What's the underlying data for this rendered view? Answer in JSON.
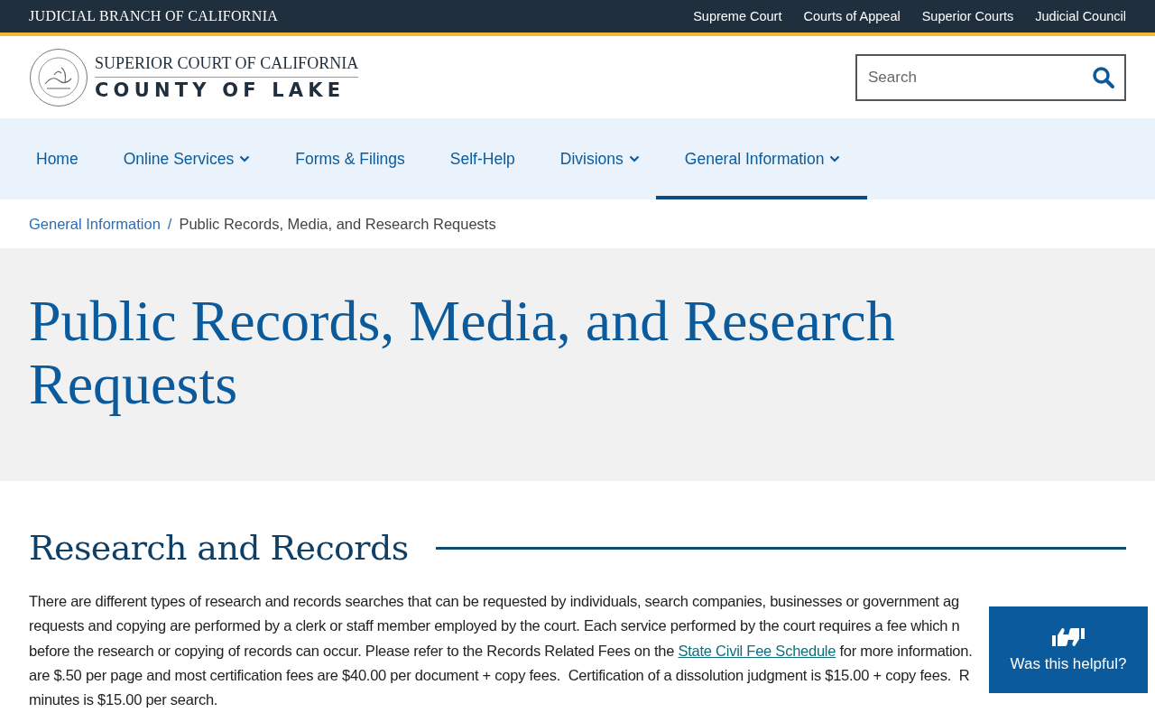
{
  "top_bar": {
    "title": "JUDICIAL BRANCH OF CALIFORNIA",
    "links": [
      "Supreme Court",
      "Courts of Appeal",
      "Superior Courts",
      "Judicial Council"
    ]
  },
  "header": {
    "logo_line_1": "SUPERIOR COURT OF CALIFORNIA",
    "logo_line_2": "COUNTY OF LAKE",
    "search": {
      "placeholder": "Search"
    }
  },
  "nav": [
    {
      "label": "Home",
      "dropdown": false,
      "selected": false
    },
    {
      "label": "Online Services",
      "dropdown": true,
      "selected": false
    },
    {
      "label": "Forms & Filings",
      "dropdown": false,
      "selected": false
    },
    {
      "label": "Self-Help",
      "dropdown": false,
      "selected": false
    },
    {
      "label": "Divisions",
      "dropdown": true,
      "selected": false
    },
    {
      "label": "General Information",
      "dropdown": true,
      "selected": true
    }
  ],
  "breadcrumb": {
    "link": "General Information",
    "separator": "/",
    "current": "Public Records, Media, and Research Requests"
  },
  "page_title": "Public Records, Media, and Research Requests",
  "section": {
    "heading": "Research and Records",
    "lines": [
      {
        "before": "There are different types of research and records searches that can be requested by individuals, search companies, businesses or government ag"
      },
      {
        "before": "requests and copying are performed by a clerk or staff member employed by the court. Each service performed by the court requires a fee which n"
      },
      {
        "before": "before the research or copying of records can occur. Please refer to the Records Related Fees on the ",
        "link": "State Civil Fee Schedule",
        "after": " for more information."
      },
      {
        "before": "are $.50 per page and most certification fees are $40.00 per document + copy fees.  Certification of a dissolution judgment is $15.00 + copy fees.  R"
      },
      {
        "before": "minutes is $15.00 per search."
      }
    ]
  },
  "feedback": {
    "label": "Was this helpful?"
  }
}
